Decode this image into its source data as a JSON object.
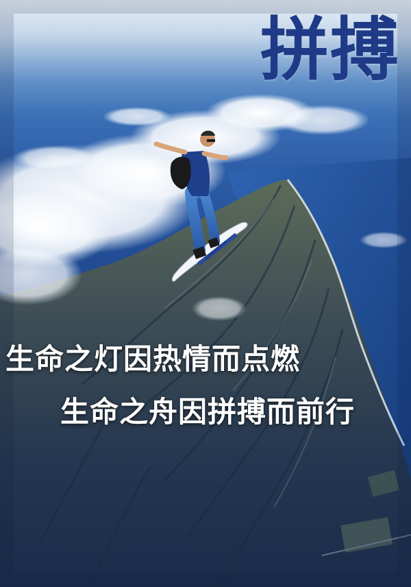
{
  "poster": {
    "title": "拼搏",
    "slogan_line_1": "生命之灯因热情而点燃",
    "slogan_line_2": "生命之舟因拼搏而前行"
  },
  "colors": {
    "title": "#1f3a86",
    "slogan": "#ffffff",
    "sky_top": "#e9f0f7",
    "ocean": "#23509a",
    "mountain": "#2f3e52",
    "cloud": "#ffffff"
  }
}
